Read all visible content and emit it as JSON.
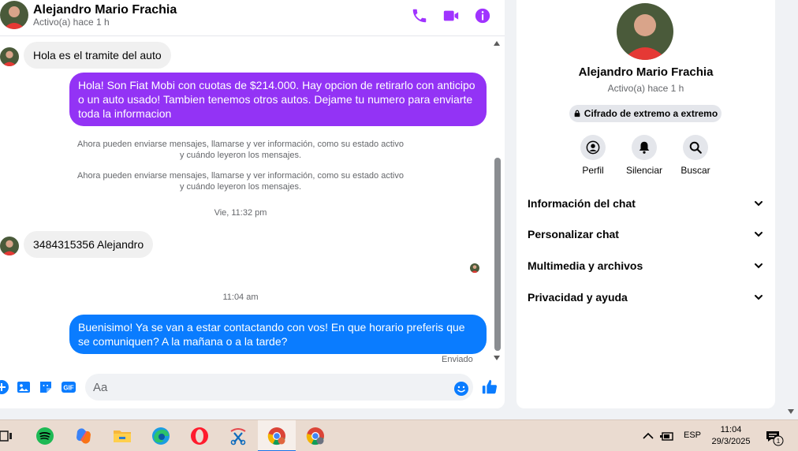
{
  "contact": {
    "name": "Alejandro Mario Frachia",
    "status": "Activo(a) hace 1 h"
  },
  "header": {
    "call_icon": "phone-icon",
    "video_icon": "video-camera-icon",
    "info_icon": "info-icon",
    "accent": "#a033ff"
  },
  "messages": {
    "m1": "Hola es el tramite  del auto",
    "m2": "Hola! Son Fiat Mobi con cuotas de $214.000. Hay opcion de retirarlo con anticipo o un auto usado! Tambien tenemos otros autos. Dejame tu numero para enviarte toda la informacion",
    "sys1_line1": "Ahora pueden enviarse mensajes, llamarse y ver información, como su estado activo",
    "sys1_line2": "y cuándo leyeron los mensajes.",
    "sys2_line1": "Ahora pueden enviarse mensajes, llamarse y ver información, como su estado activo",
    "sys2_line2": "y cuándo leyeron los mensajes.",
    "time1": "Vie, 11:32 pm",
    "m3": "3484315356 Alejandro",
    "time2": "11:04 am",
    "m4": "Buenisimo! Ya se van a estar contactando con vos! En que horario preferis que se comuniquen? A la mañana o a la tarde?",
    "sent_label": "Enviado",
    "outgoing_purple": "#9333f5",
    "outgoing_blue": "#0a7cff"
  },
  "composer": {
    "placeholder": "Aa",
    "gif_label": "GIF",
    "icons": [
      "plus-circle-icon",
      "photo-icon",
      "sticker-icon",
      "gif-icon",
      "emoji-icon",
      "thumbs-up-icon"
    ]
  },
  "info_panel": {
    "e2e_badge": "Cifrado de extremo a extremo",
    "actions": [
      {
        "label": "Perfil",
        "icon": "profile-icon"
      },
      {
        "label": "Silenciar",
        "icon": "bell-icon"
      },
      {
        "label": "Buscar",
        "icon": "search-icon"
      }
    ],
    "sections": [
      {
        "label": "Información del chat"
      },
      {
        "label": "Personalizar chat"
      },
      {
        "label": "Multimedia y archivos"
      },
      {
        "label": "Privacidad y ayuda"
      }
    ]
  },
  "taskbar": {
    "apps": [
      "task-view-icon",
      "spotify-icon",
      "copilot-icon",
      "file-explorer-icon",
      "edge-icon",
      "opera-icon",
      "snipping-tool-icon",
      "chrome-icon",
      "chrome-profile-icon"
    ],
    "language": "ESP",
    "time": "11:04",
    "date": "29/3/2025",
    "notification_count": "1"
  }
}
